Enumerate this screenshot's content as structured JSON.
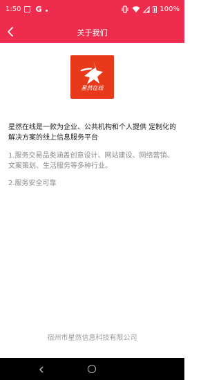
{
  "status_bar": {
    "time": "1:50",
    "g_label": "G",
    "battery": "100%"
  },
  "app_bar": {
    "title": "关于我们",
    "back_icon": "chevron-left-icon"
  },
  "logo": {
    "text": "星然在线",
    "bg_color": "#e8391b"
  },
  "content": {
    "intro": "星然在线是一款为企业、公共机构和个人提供 定制化的解决方案的线上信息服务平台",
    "features": [
      "1.服务交易品类涵盖创意设计、网站建设、网络营销、文案策划、生活服务等多种行业。",
      "2.服务安全可靠"
    ]
  },
  "footer": {
    "company": "宿州市星然信息科技有限公司"
  },
  "colors": {
    "accent": "#ee2d4e"
  }
}
